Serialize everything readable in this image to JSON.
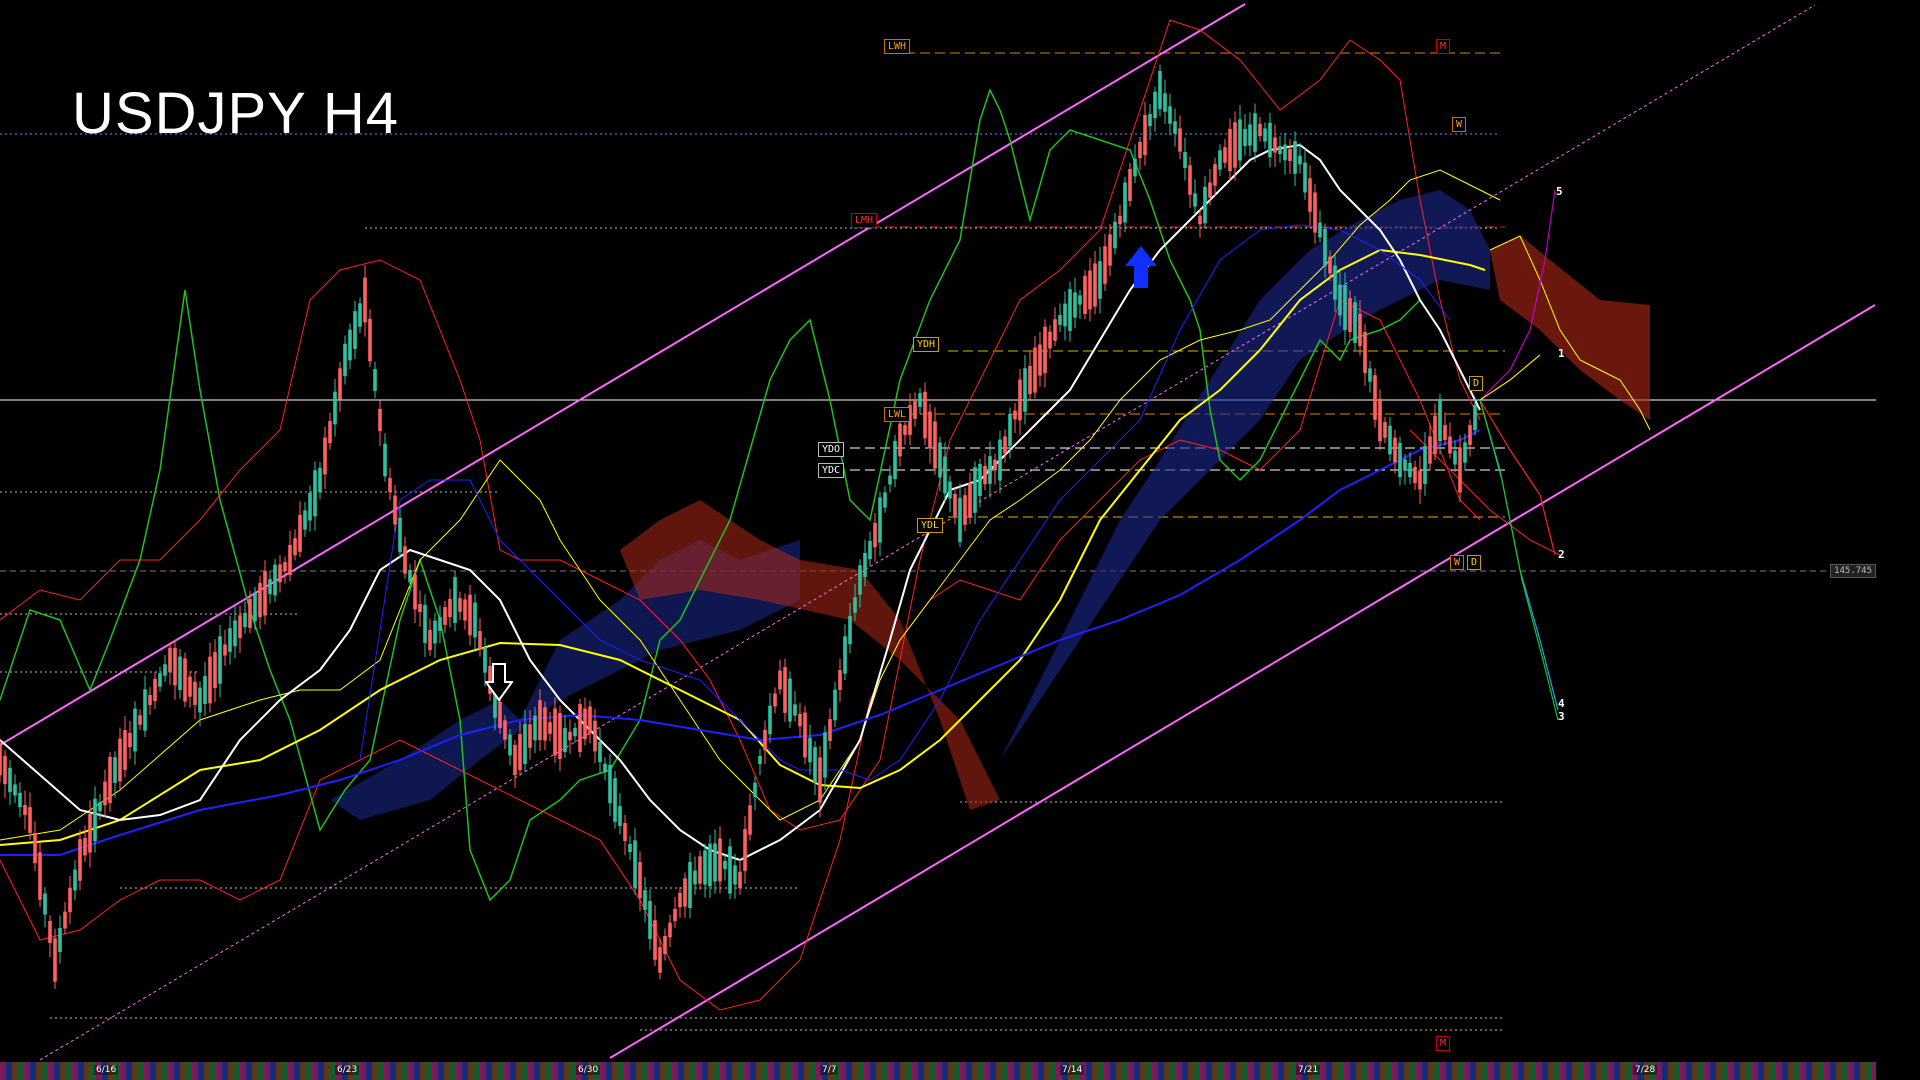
{
  "chart": {
    "title": "USDJPY H4"
  },
  "levels": {
    "lwh": "LWH",
    "lwh_marker": "M",
    "weekly": "W",
    "lmh": "LMH",
    "ydh": "YDH",
    "lwl": "LWL",
    "ydo": "YDO",
    "ydc": "YDC",
    "ydl": "YDL",
    "daily_top": "D",
    "daily_bottom": "D",
    "weekly_bottom": "W",
    "bottom_marker": "M"
  },
  "waves": {
    "w5": "5",
    "w1": "1",
    "w2": "2",
    "w4": "4",
    "w3": "3"
  },
  "price_tag": "145.745",
  "dates": [
    "6/16",
    "6/23",
    "6/30",
    "7/7",
    "7/14",
    "7/21",
    "7/28"
  ],
  "colors": {
    "channel": "#ff66ff",
    "cloud_red": "#c83020",
    "cloud_blue": "#2040c0",
    "candle_up": "#30c0a0",
    "candle_down": "#ff6060",
    "ma_white": "#ffffff",
    "ma_yellow": "#ffff00",
    "ma_blue": "#2020ff",
    "rsi_green": "#20c020"
  }
}
